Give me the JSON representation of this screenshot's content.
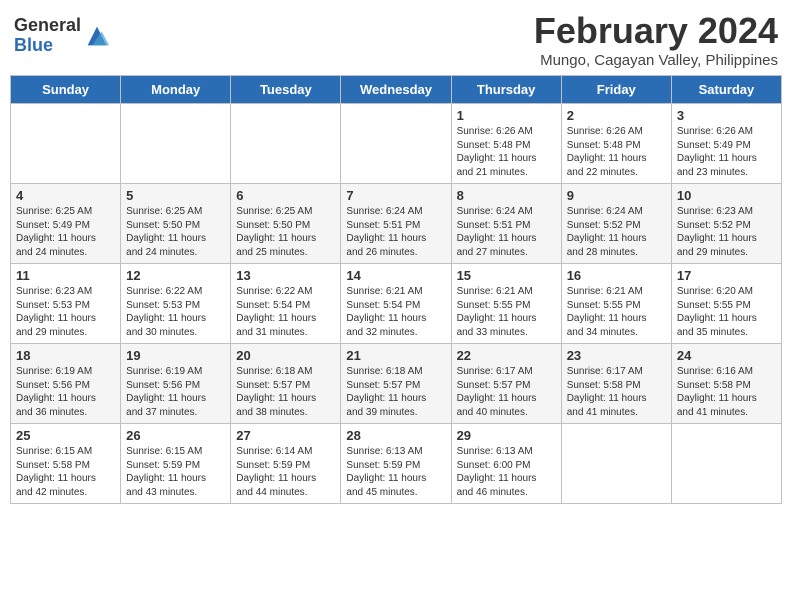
{
  "header": {
    "logo_general": "General",
    "logo_blue": "Blue",
    "month_year": "February 2024",
    "location": "Mungo, Cagayan Valley, Philippines"
  },
  "days_of_week": [
    "Sunday",
    "Monday",
    "Tuesday",
    "Wednesday",
    "Thursday",
    "Friday",
    "Saturday"
  ],
  "weeks": [
    [
      {
        "day": "",
        "info": ""
      },
      {
        "day": "",
        "info": ""
      },
      {
        "day": "",
        "info": ""
      },
      {
        "day": "",
        "info": ""
      },
      {
        "day": "1",
        "info": "Sunrise: 6:26 AM\nSunset: 5:48 PM\nDaylight: 11 hours and 21 minutes."
      },
      {
        "day": "2",
        "info": "Sunrise: 6:26 AM\nSunset: 5:48 PM\nDaylight: 11 hours and 22 minutes."
      },
      {
        "day": "3",
        "info": "Sunrise: 6:26 AM\nSunset: 5:49 PM\nDaylight: 11 hours and 23 minutes."
      }
    ],
    [
      {
        "day": "4",
        "info": "Sunrise: 6:25 AM\nSunset: 5:49 PM\nDaylight: 11 hours and 24 minutes."
      },
      {
        "day": "5",
        "info": "Sunrise: 6:25 AM\nSunset: 5:50 PM\nDaylight: 11 hours and 24 minutes."
      },
      {
        "day": "6",
        "info": "Sunrise: 6:25 AM\nSunset: 5:50 PM\nDaylight: 11 hours and 25 minutes."
      },
      {
        "day": "7",
        "info": "Sunrise: 6:24 AM\nSunset: 5:51 PM\nDaylight: 11 hours and 26 minutes."
      },
      {
        "day": "8",
        "info": "Sunrise: 6:24 AM\nSunset: 5:51 PM\nDaylight: 11 hours and 27 minutes."
      },
      {
        "day": "9",
        "info": "Sunrise: 6:24 AM\nSunset: 5:52 PM\nDaylight: 11 hours and 28 minutes."
      },
      {
        "day": "10",
        "info": "Sunrise: 6:23 AM\nSunset: 5:52 PM\nDaylight: 11 hours and 29 minutes."
      }
    ],
    [
      {
        "day": "11",
        "info": "Sunrise: 6:23 AM\nSunset: 5:53 PM\nDaylight: 11 hours and 29 minutes."
      },
      {
        "day": "12",
        "info": "Sunrise: 6:22 AM\nSunset: 5:53 PM\nDaylight: 11 hours and 30 minutes."
      },
      {
        "day": "13",
        "info": "Sunrise: 6:22 AM\nSunset: 5:54 PM\nDaylight: 11 hours and 31 minutes."
      },
      {
        "day": "14",
        "info": "Sunrise: 6:21 AM\nSunset: 5:54 PM\nDaylight: 11 hours and 32 minutes."
      },
      {
        "day": "15",
        "info": "Sunrise: 6:21 AM\nSunset: 5:55 PM\nDaylight: 11 hours and 33 minutes."
      },
      {
        "day": "16",
        "info": "Sunrise: 6:21 AM\nSunset: 5:55 PM\nDaylight: 11 hours and 34 minutes."
      },
      {
        "day": "17",
        "info": "Sunrise: 6:20 AM\nSunset: 5:55 PM\nDaylight: 11 hours and 35 minutes."
      }
    ],
    [
      {
        "day": "18",
        "info": "Sunrise: 6:19 AM\nSunset: 5:56 PM\nDaylight: 11 hours and 36 minutes."
      },
      {
        "day": "19",
        "info": "Sunrise: 6:19 AM\nSunset: 5:56 PM\nDaylight: 11 hours and 37 minutes."
      },
      {
        "day": "20",
        "info": "Sunrise: 6:18 AM\nSunset: 5:57 PM\nDaylight: 11 hours and 38 minutes."
      },
      {
        "day": "21",
        "info": "Sunrise: 6:18 AM\nSunset: 5:57 PM\nDaylight: 11 hours and 39 minutes."
      },
      {
        "day": "22",
        "info": "Sunrise: 6:17 AM\nSunset: 5:57 PM\nDaylight: 11 hours and 40 minutes."
      },
      {
        "day": "23",
        "info": "Sunrise: 6:17 AM\nSunset: 5:58 PM\nDaylight: 11 hours and 41 minutes."
      },
      {
        "day": "24",
        "info": "Sunrise: 6:16 AM\nSunset: 5:58 PM\nDaylight: 11 hours and 41 minutes."
      }
    ],
    [
      {
        "day": "25",
        "info": "Sunrise: 6:15 AM\nSunset: 5:58 PM\nDaylight: 11 hours and 42 minutes."
      },
      {
        "day": "26",
        "info": "Sunrise: 6:15 AM\nSunset: 5:59 PM\nDaylight: 11 hours and 43 minutes."
      },
      {
        "day": "27",
        "info": "Sunrise: 6:14 AM\nSunset: 5:59 PM\nDaylight: 11 hours and 44 minutes."
      },
      {
        "day": "28",
        "info": "Sunrise: 6:13 AM\nSunset: 5:59 PM\nDaylight: 11 hours and 45 minutes."
      },
      {
        "day": "29",
        "info": "Sunrise: 6:13 AM\nSunset: 6:00 PM\nDaylight: 11 hours and 46 minutes."
      },
      {
        "day": "",
        "info": ""
      },
      {
        "day": "",
        "info": ""
      }
    ]
  ]
}
